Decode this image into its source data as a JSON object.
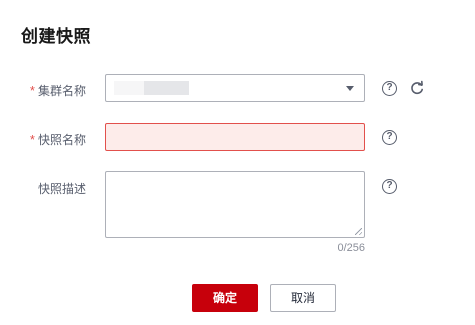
{
  "dialog": {
    "title": "创建快照"
  },
  "form": {
    "required_mark": "*",
    "cluster": {
      "label": "集群名称",
      "value": ""
    },
    "snapshot_name": {
      "label": "快照名称",
      "value": "",
      "state": "error"
    },
    "description": {
      "label": "快照描述",
      "value": "",
      "counter": "0/256"
    },
    "help_glyph": "?"
  },
  "buttons": {
    "confirm_label": "确定",
    "cancel_label": "取消"
  },
  "colors": {
    "primary": "#c7000b",
    "required": "#e2504c",
    "error_bg": "#fdecea"
  },
  "icons": {
    "help": "question-circle-icon",
    "refresh": "refresh-icon",
    "dropdown": "chevron-down-icon"
  }
}
